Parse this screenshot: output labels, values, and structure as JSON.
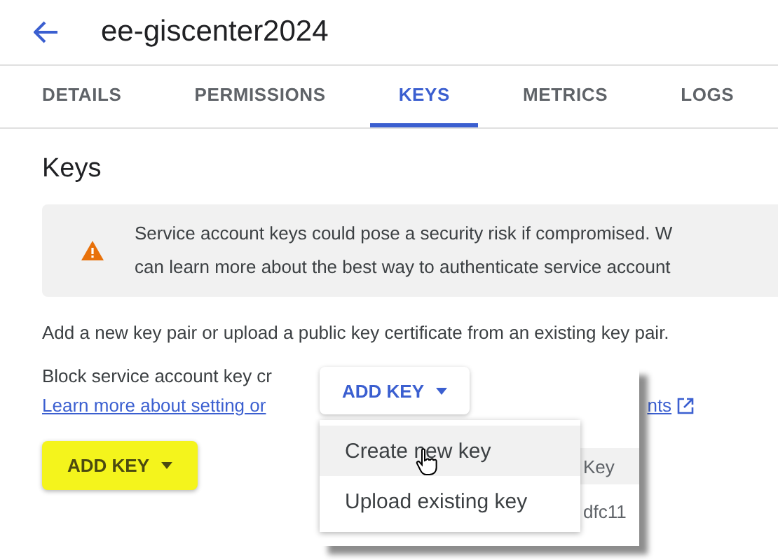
{
  "header": {
    "title": "ee-giscenter2024"
  },
  "tabs": [
    {
      "label": "DETAILS",
      "selected": false
    },
    {
      "label": "PERMISSIONS",
      "selected": false
    },
    {
      "label": "KEYS",
      "selected": true
    },
    {
      "label": "METRICS",
      "selected": false
    },
    {
      "label": "LOGS",
      "selected": false
    }
  ],
  "section_title": "Keys",
  "warning": {
    "lines": [
      "Service account keys could pose a security risk if compromised. W",
      "can learn more about the best way to authenticate service account"
    ]
  },
  "intro": "Add a new key pair or upload a public key certificate from an existing key pair.",
  "block_text": "Block service account key cr",
  "link": {
    "start": "Learn more about setting or",
    "end": "nts"
  },
  "add_key_button": {
    "label": "ADD KEY",
    "highlighted": true
  },
  "popup": {
    "button": "ADD KEY",
    "menu": [
      {
        "label": "Create new key",
        "selected": true
      },
      {
        "label": "Upload existing key",
        "selected": false
      }
    ],
    "table_header": "Key",
    "table_cell": "dfc11"
  }
}
